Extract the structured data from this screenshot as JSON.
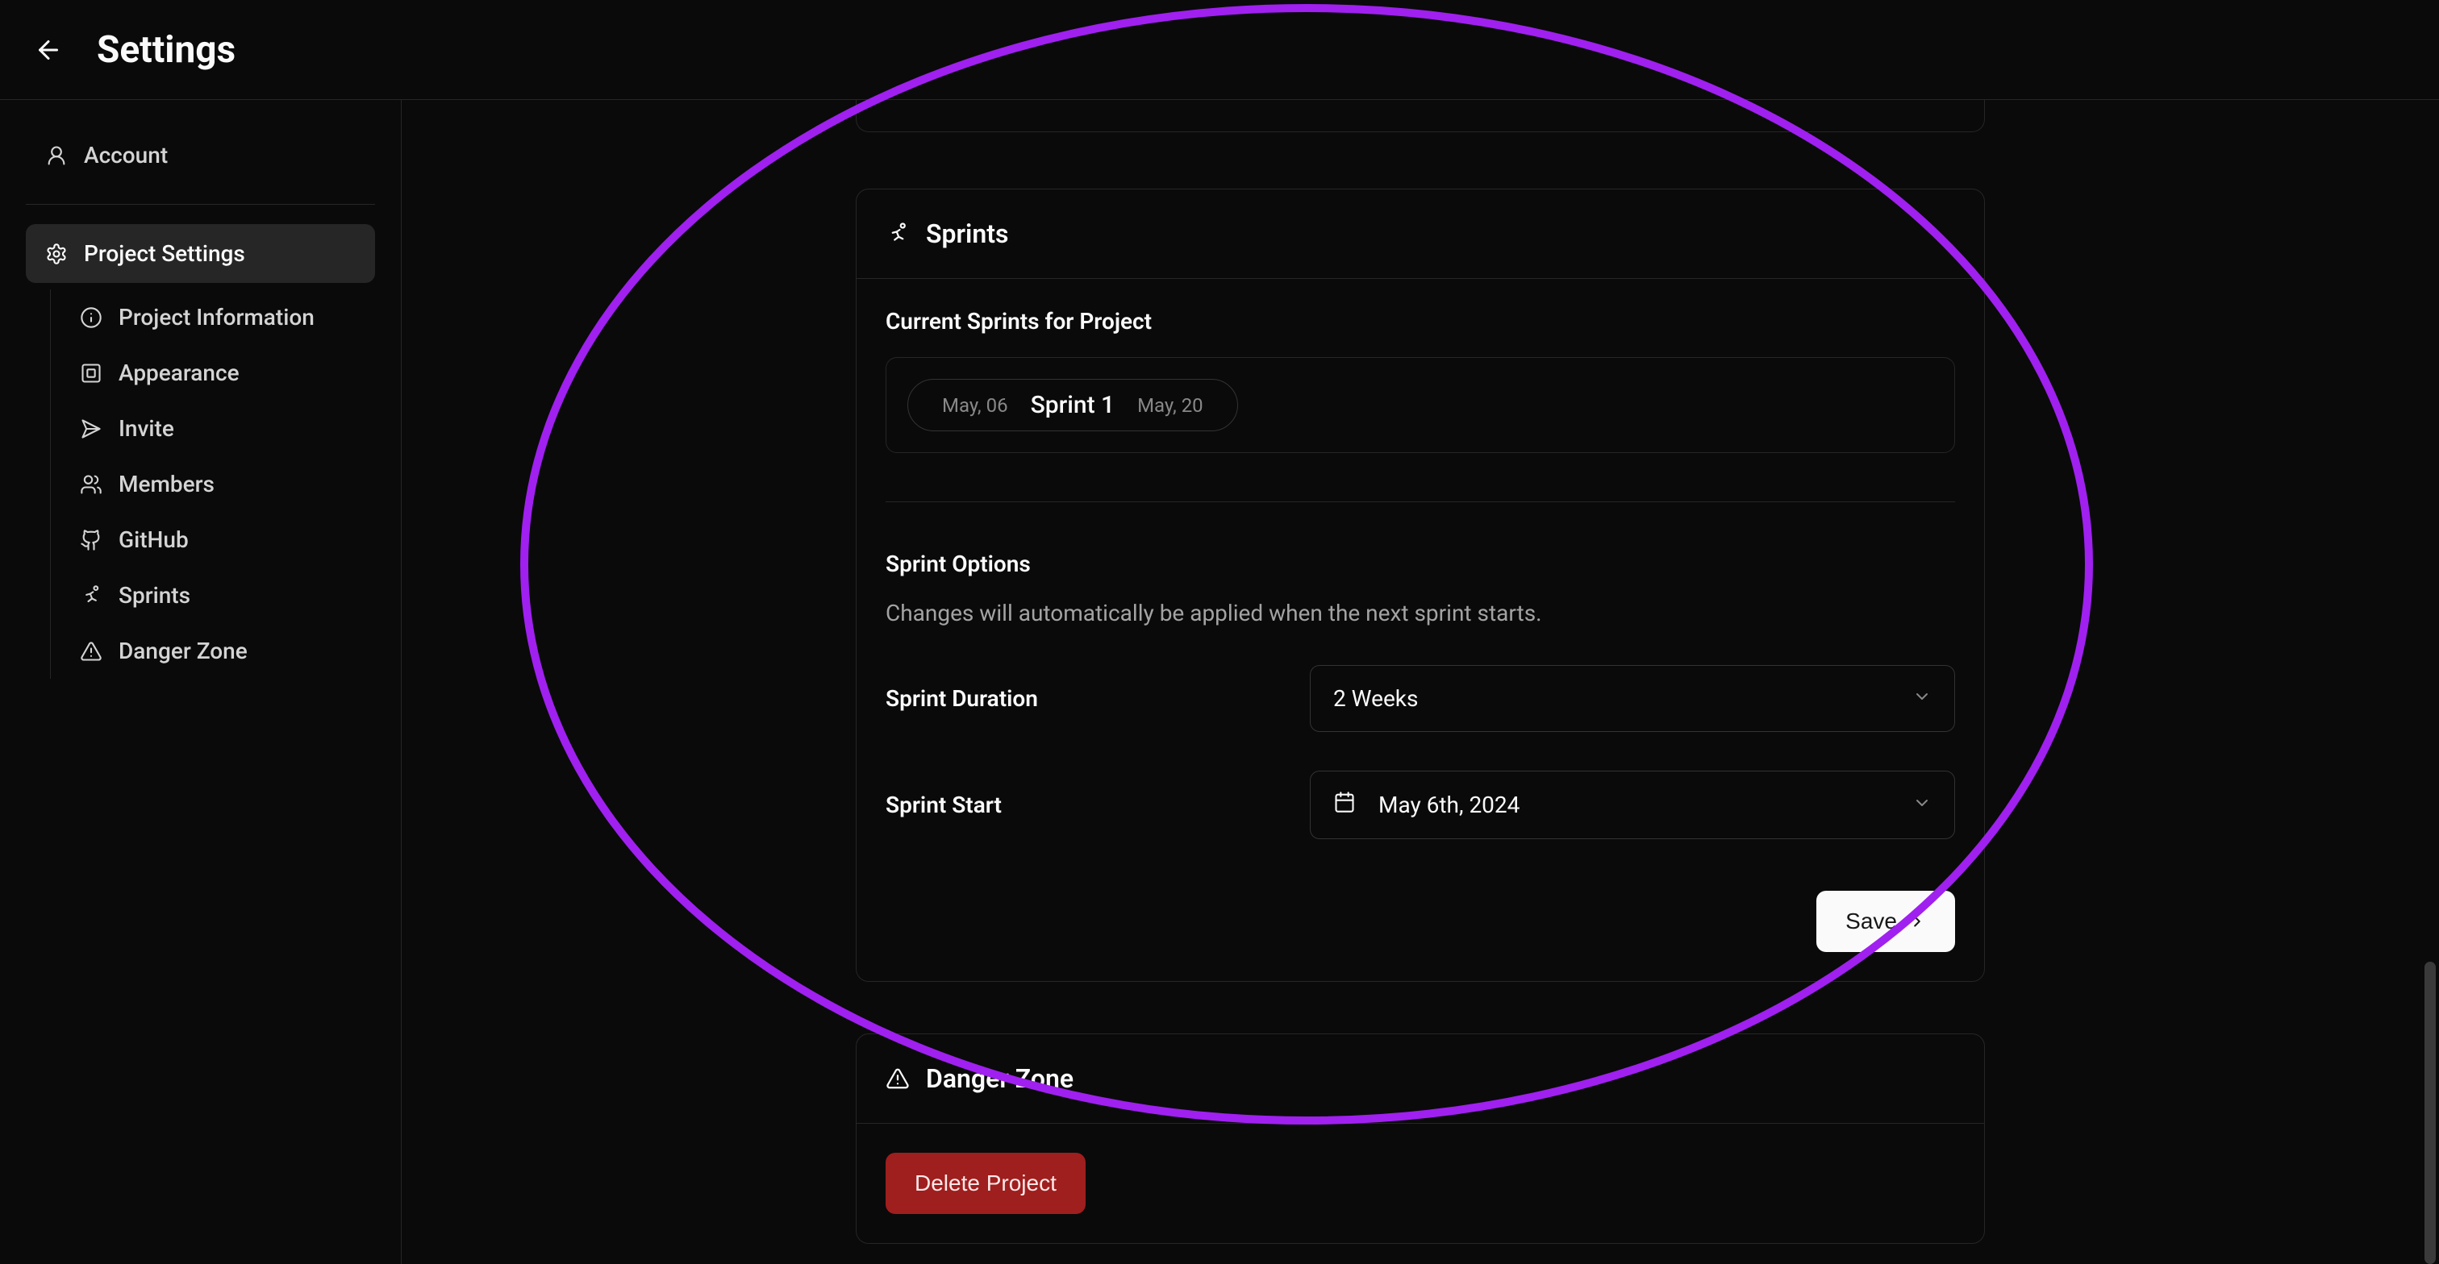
{
  "header": {
    "title": "Settings"
  },
  "sidebar": {
    "account_label": "Account",
    "project_settings_label": "Project Settings",
    "sub": {
      "project_information": "Project Information",
      "appearance": "Appearance",
      "invite": "Invite",
      "members": "Members",
      "github": "GitHub",
      "sprints": "Sprints",
      "danger_zone": "Danger Zone"
    }
  },
  "sprints_card": {
    "title": "Sprints",
    "current_label": "Current Sprints for Project",
    "items": [
      {
        "start": "May, 06",
        "name": "Sprint 1",
        "end": "May, 20"
      }
    ],
    "options_label": "Sprint Options",
    "options_sub": "Changes will automatically be applied when the next sprint starts.",
    "duration_label": "Sprint Duration",
    "duration_value": "2 Weeks",
    "start_label": "Sprint Start",
    "start_value": "May 6th, 2024",
    "save_label": "Save"
  },
  "danger_card": {
    "title": "Danger Zone",
    "delete_label": "Delete Project"
  }
}
